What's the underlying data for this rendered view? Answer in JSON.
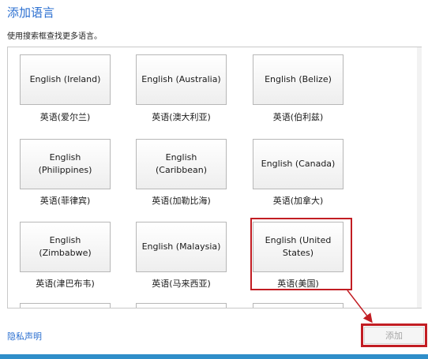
{
  "header": {
    "title": "添加语言",
    "subtitle": "使用搜索框查找更多语言。"
  },
  "languages": [
    {
      "button": "English (Ireland)",
      "label": "英语(爱尔兰)"
    },
    {
      "button": "English (Australia)",
      "label": "英语(澳大利亚)"
    },
    {
      "button": "English (Belize)",
      "label": "英语(伯利兹)"
    },
    {
      "button": "English (Philippines)",
      "label": "英语(菲律宾)"
    },
    {
      "button": "English (Caribbean)",
      "label": "英语(加勒比海)"
    },
    {
      "button": "English (Canada)",
      "label": "英语(加拿大)"
    },
    {
      "button": "English (Zimbabwe)",
      "label": "英语(津巴布韦)"
    },
    {
      "button": "English (Malaysia)",
      "label": "英语(马来西亚)"
    },
    {
      "button": "English (United States)",
      "label": "英语(美国)"
    }
  ],
  "footer": {
    "privacy_link": "隐私声明",
    "add_label": "添加"
  },
  "colors": {
    "accent": "#2b6fd0",
    "highlight": "#c21d23",
    "bottom_bar": "#2f8ec9"
  }
}
